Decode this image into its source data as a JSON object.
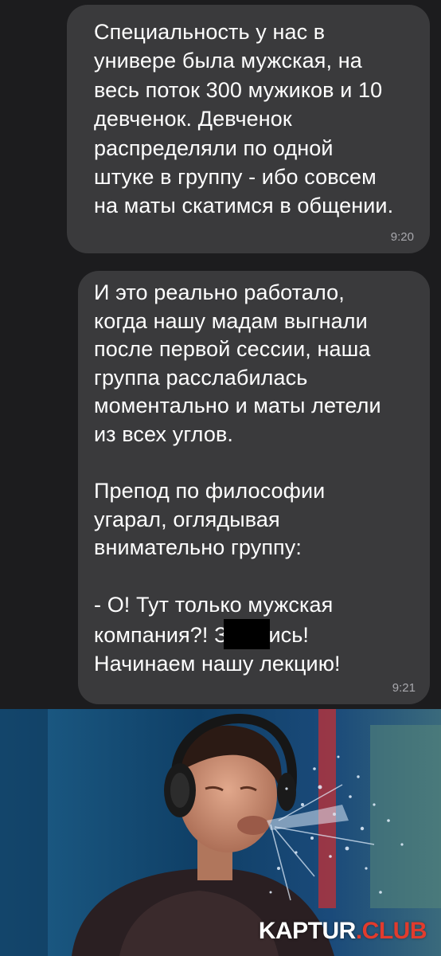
{
  "messages": [
    {
      "text": "Специальность у нас в\nунивере была мужская, на\nвесь поток 300 мужиков и 10\nдевченок. Девченок\nраспределяли по одной\nштуке в группу - ибо совсем\nна маты скатимся в общении.",
      "time": "9:20"
    },
    {
      "text_part1": "И это реально работало,\nкогда нашу мадам выгнали\nпосле первой сессии, наша\nгруппа расслабилась\nмоментально и маты летели\nиз всех углов.\n\nПрепод по философии\nугарал, оглядывая\nвнимательно группу:\n\n- О! Тут только мужская\nкомпания?! З",
      "text_part2": "ись!\nНачинаем нашу лекцию!",
      "time": "9:21"
    }
  ],
  "meme": {
    "watermark_part1": "KAPTUR",
    "watermark_part2": ".CLUB"
  },
  "colors": {
    "background": "#1c1c1e",
    "bubble": "#3a3a3c",
    "timestamp": "#a8a8ad",
    "watermark_accent": "#e23b2d"
  }
}
